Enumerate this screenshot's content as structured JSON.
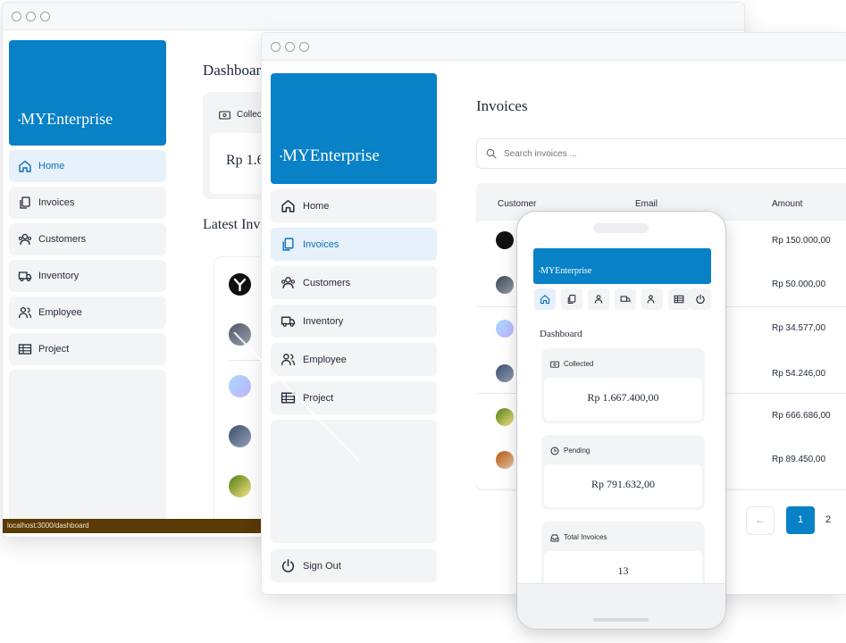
{
  "brand": {
    "dot": "•",
    "name": "MYEnterprise",
    "color": "#0881c6"
  },
  "window_back": {
    "page_title": "Dashboard",
    "collected_label": "Collected",
    "collected_value": "Rp 1.667.400,00",
    "section_title": "Latest Invoices",
    "status_url": "localhost:3000/dashboard",
    "nav": [
      "Home",
      "Invoices",
      "Customers",
      "Inventory",
      "Employee",
      "Project"
    ]
  },
  "window_mid": {
    "page_title": "Invoices",
    "search_placeholder": "Search invoices ...",
    "columns": [
      "Customer",
      "Email",
      "Amount"
    ],
    "amounts": [
      "Rp 150.000,00",
      "Rp 50.000,00",
      "Rp 34.577,00",
      "Rp 54.246,00",
      "Rp 666.686,00",
      "Rp 89.450,00"
    ],
    "nav": [
      "Home",
      "Invoices",
      "Customers",
      "Inventory",
      "Employee",
      "Project"
    ],
    "sign_out": "Sign Out",
    "pagination": {
      "prev": "←",
      "pages": [
        "1",
        "2"
      ],
      "current": "1"
    }
  },
  "phone": {
    "page_title": "Dashboard",
    "cards": [
      {
        "label": "Collected",
        "value": "Rp 1.667.400,00",
        "icon": "banknote-icon"
      },
      {
        "label": "Pending",
        "value": "Rp 791.632,00",
        "icon": "clock-icon"
      },
      {
        "label": "Total Invoices",
        "value": "13",
        "icon": "inbox-icon"
      }
    ]
  },
  "icons": [
    "home-icon",
    "files-icon",
    "customers-icon",
    "truck-icon",
    "users-icon",
    "table-icon",
    "power-icon"
  ]
}
